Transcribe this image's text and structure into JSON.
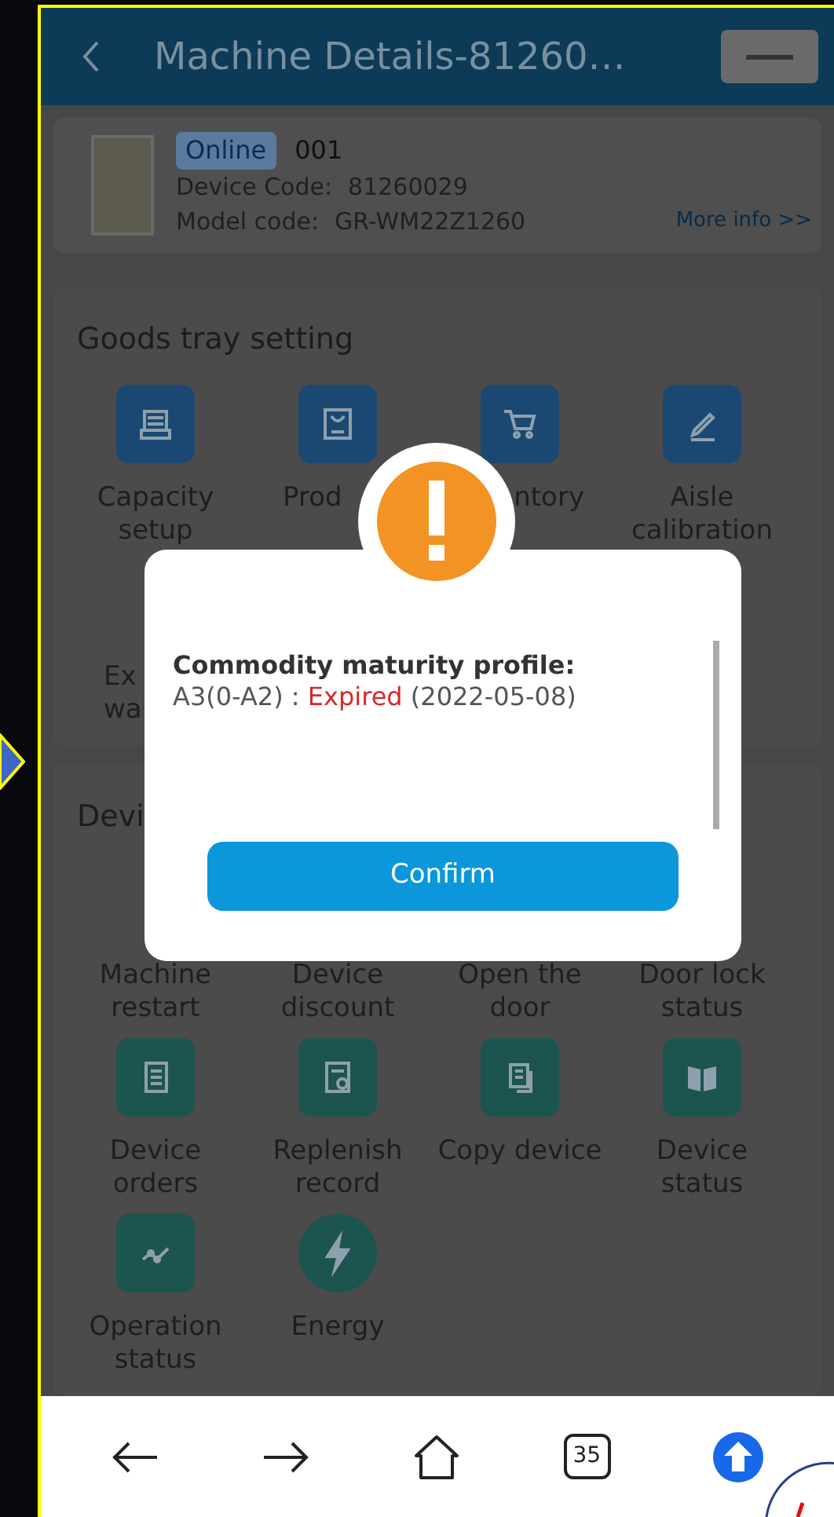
{
  "header": {
    "title": "Machine Details-81260…"
  },
  "device": {
    "status": "Online",
    "name": "001",
    "device_code_label": "Device Code:",
    "device_code": "81260029",
    "model_code_label": "Model code:",
    "model_code": "GR-WM22Z1260",
    "more_info": "More info >>"
  },
  "sections": [
    {
      "title": "Goods tray setting",
      "items": [
        {
          "kind": "tray",
          "label": [
            "Capacity",
            "setup"
          ]
        },
        {
          "kind": "bag",
          "label": [
            "Prod"
          ]
        },
        {
          "kind": "cart",
          "label": [
            "ntory"
          ]
        },
        {
          "kind": "pencil",
          "label": [
            "Aisle",
            "calibration"
          ]
        },
        {
          "kind": "hidden",
          "label": [
            "Ex",
            "wa"
          ]
        }
      ]
    },
    {
      "title": "Devi",
      "items": [
        {
          "kind": "hidden",
          "label": [
            "Machine",
            "restart"
          ]
        },
        {
          "kind": "hidden",
          "label": [
            "Device",
            "discount"
          ]
        },
        {
          "kind": "hidden",
          "label": [
            "Open the",
            "door"
          ]
        },
        {
          "kind": "hidden",
          "label": [
            "Door lock",
            "status"
          ]
        },
        {
          "kind": "receipt",
          "label": [
            "Device",
            "orders"
          ]
        },
        {
          "kind": "search",
          "label": [
            "Replenish",
            "record"
          ]
        },
        {
          "kind": "copy",
          "label": [
            "Copy device"
          ]
        },
        {
          "kind": "book",
          "label": [
            "Device",
            "status"
          ]
        },
        {
          "kind": "chart",
          "label": [
            "Operation",
            "status"
          ]
        },
        {
          "kind": "bolt",
          "label": [
            "Energy"
          ]
        }
      ]
    }
  ],
  "dialog": {
    "title": "Commodity maturity profile:",
    "prefix": "A3(0-A2) : ",
    "status": "Expired",
    "date": " (2022-05-08)",
    "confirm": "Confirm"
  },
  "browser_nav": {
    "tab_count": "35"
  }
}
